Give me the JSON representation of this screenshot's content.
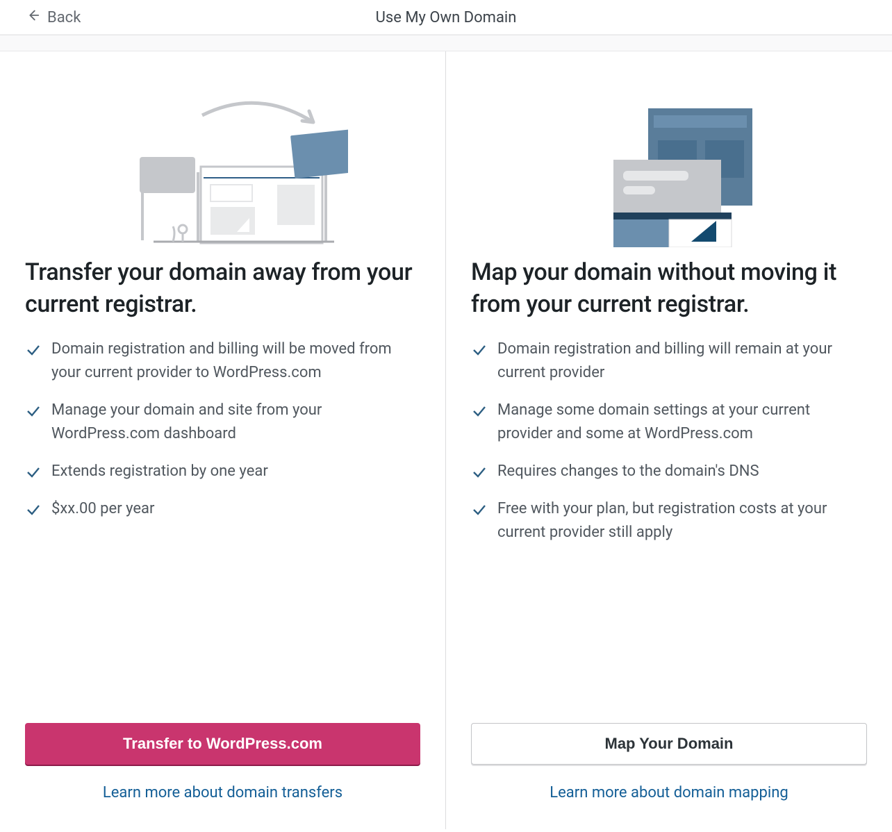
{
  "header": {
    "back_label": "Back",
    "title": "Use My Own Domain"
  },
  "transfer": {
    "heading": "Transfer your domain away from your current registrar.",
    "bullets": [
      "Domain registration and billing will be moved from your current provider to WordPress.com",
      "Manage your domain and site from your WordPress.com dashboard",
      "Extends registration by one year",
      "$xx.00 per year"
    ],
    "cta": "Transfer to WordPress.com",
    "learn": "Learn more about domain transfers"
  },
  "mapping": {
    "heading": "Map your domain without moving it from your current registrar.",
    "bullets": [
      "Domain registration and billing will remain at your current provider",
      "Manage some domain settings at your current provider and some at WordPress.com",
      "Requires changes to the domain's DNS",
      "Free with your plan, but registration costs at your current provider still apply"
    ],
    "cta": "Map Your Domain",
    "learn": "Learn more about domain mapping"
  }
}
